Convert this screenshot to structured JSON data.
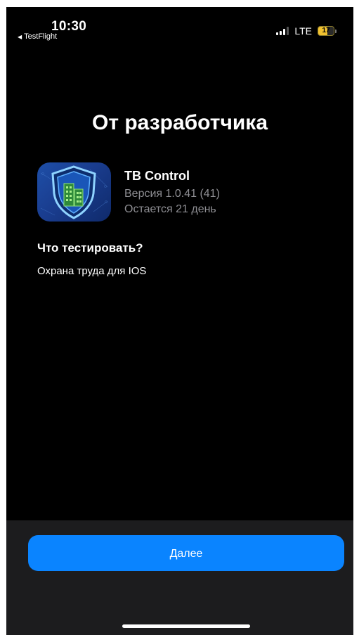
{
  "status_bar": {
    "time": "10:30",
    "back_app": "TestFlight",
    "network": "LTE",
    "battery_level": "17",
    "battery_fraction": 0.17
  },
  "screen": {
    "title": "От разработчика"
  },
  "app": {
    "name": "TB Control",
    "version": "Версия 1.0.41 (41)",
    "expires": "Остается 21 день",
    "icon": "shield-building-icon"
  },
  "what_to_test": {
    "title": "Что тестировать?",
    "text": "Охрана труда для IOS"
  },
  "actions": {
    "next_label": "Далее"
  },
  "colors": {
    "background": "#000000",
    "accent": "#0a84ff",
    "secondary_text": "#8e8e93",
    "bottom_panel": "#1c1c1e",
    "battery": "#f2c230"
  }
}
